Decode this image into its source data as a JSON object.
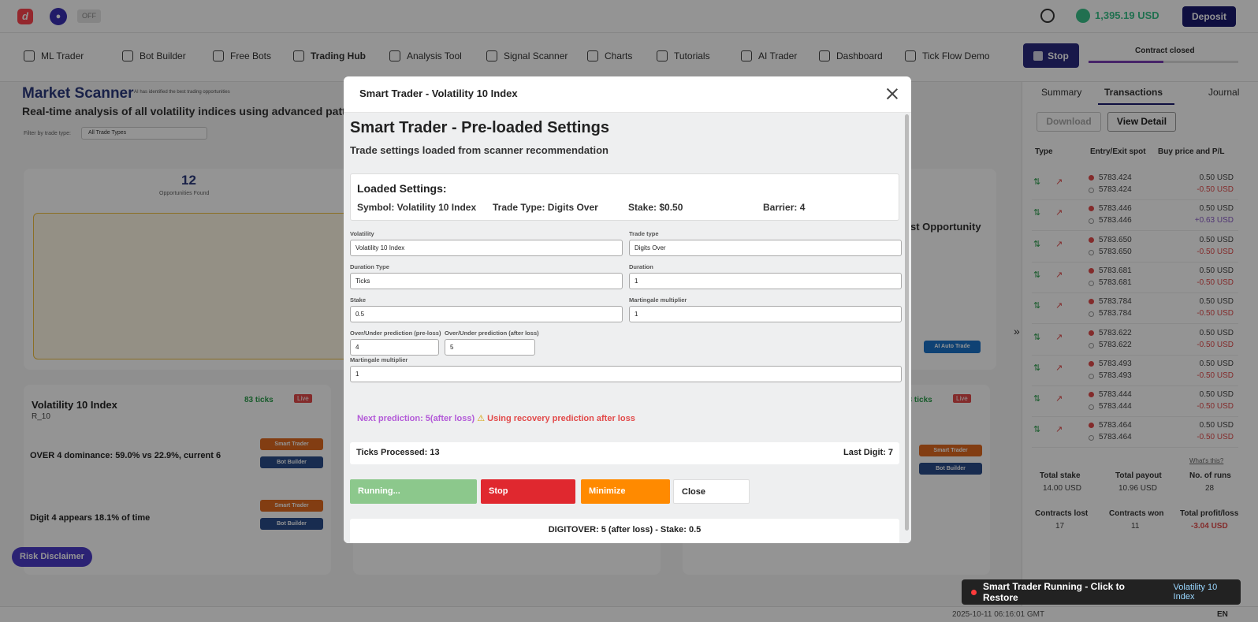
{
  "topbar": {
    "logo": "d",
    "off_label": "OFF",
    "balance": "1,395.19 USD",
    "deposit_label": "Deposit"
  },
  "nav": {
    "items": [
      "ML Trader",
      "Bot Builder",
      "Free Bots",
      "Trading Hub",
      "Analysis Tool",
      "Signal Scanner",
      "Charts",
      "Tutorials",
      "AI Trader",
      "Dashboard",
      "Tick Flow Demo"
    ],
    "active": "Trading Hub",
    "stop_label": "Stop",
    "contract_status": "Contract closed"
  },
  "scanner": {
    "title": "Market Scanner",
    "badge": "AI has identified the best trading opportunities",
    "subtitle": "Real-time analysis of all volatility indices using advanced pattern",
    "filter_label": "Filter by trade type:",
    "filter_value": "All Trade Types",
    "opportunities_count": "12",
    "opportunities_label": "Opportunities Found",
    "best_opportunity": "st Opportunity",
    "ai_auto_trade": "AI Auto Trade",
    "card": {
      "title": "Volatility 10 Index",
      "symbol": "R_10",
      "ticks": "83 ticks",
      "live": "Live",
      "line1": "OVER 4 dominance: 59.0% vs 22.9%, current 6",
      "line2": "Digit 4 appears 18.1% of time",
      "smart_trader": "Smart Trader",
      "bot_builder": "Bot Builder"
    },
    "risk_disclaimer": "Risk Disclaimer"
  },
  "right_panel": {
    "tabs": [
      "Summary",
      "Transactions",
      "Journal"
    ],
    "active_tab": "Transactions",
    "download_label": "Download",
    "view_detail_label": "View Detail",
    "headers": [
      "Type",
      "Entry/Exit spot",
      "Buy price and P/L"
    ],
    "transactions": [
      {
        "entry": "5783.424",
        "exit": "5783.424",
        "buy": "0.50 USD",
        "pl": "-0.50 USD"
      },
      {
        "entry": "5783.446",
        "exit": "5783.446",
        "buy": "0.50 USD",
        "pl": "+0.63 USD"
      },
      {
        "entry": "5783.650",
        "exit": "5783.650",
        "buy": "0.50 USD",
        "pl": "-0.50 USD"
      },
      {
        "entry": "5783.681",
        "exit": "5783.681",
        "buy": "0.50 USD",
        "pl": "-0.50 USD"
      },
      {
        "entry": "5783.784",
        "exit": "5783.784",
        "buy": "0.50 USD",
        "pl": "-0.50 USD"
      },
      {
        "entry": "5783.622",
        "exit": "5783.622",
        "buy": "0.50 USD",
        "pl": "-0.50 USD"
      },
      {
        "entry": "5783.493",
        "exit": "5783.493",
        "buy": "0.50 USD",
        "pl": "-0.50 USD"
      },
      {
        "entry": "5783.444",
        "exit": "5783.444",
        "buy": "0.50 USD",
        "pl": "-0.50 USD"
      },
      {
        "entry": "5783.464",
        "exit": "5783.464",
        "buy": "0.50 USD",
        "pl": "-0.50 USD"
      }
    ],
    "whats_this": "What's this?",
    "stats": {
      "total_stake_label": "Total stake",
      "total_stake": "14.00 USD",
      "total_payout_label": "Total payout",
      "total_payout": "10.96 USD",
      "runs_label": "No. of runs",
      "runs": "28",
      "lost_label": "Contracts lost",
      "lost": "17",
      "won_label": "Contracts won",
      "won": "11",
      "pl_label": "Total profit/loss",
      "pl": "-3.04 USD"
    }
  },
  "statusbar": {
    "time": "2025-10-11 06:16:01 GMT",
    "lang": "EN"
  },
  "toast": {
    "text": "Smart Trader Running - Click to Restore",
    "symbol": "Volatility 10 Index"
  },
  "modal": {
    "title": "Smart Trader - Volatility 10 Index",
    "heading": "Smart Trader - Pre-loaded Settings",
    "subheading": "Trade settings loaded from scanner recommendation",
    "loaded": {
      "title": "Loaded Settings:",
      "symbol": "Symbol: Volatility 10 Index",
      "trade_type": "Trade Type: Digits Over",
      "stake": "Stake: $0.50",
      "barrier": "Barrier: 4"
    },
    "fields": {
      "volatility_label": "Volatility",
      "volatility": "Volatility 10 Index",
      "trade_type_label": "Trade type",
      "trade_type": "Digits Over",
      "duration_type_label": "Duration Type",
      "duration_type": "Ticks",
      "duration_label": "Duration",
      "duration": "1",
      "stake_label": "Stake",
      "stake": "0.5",
      "martingale_label": "Martingale multiplier",
      "martingale": "1",
      "pre_loss_label": "Over/Under prediction (pre-loss)",
      "pre_loss": "4",
      "after_loss_label": "Over/Under prediction (after loss)",
      "after_loss": "5",
      "martingale2_label": "Martingale multiplier",
      "martingale2": "1"
    },
    "next_prediction": "Next prediction: 5(after loss)",
    "recovery": "Using recovery prediction after loss",
    "ticks_processed": "Ticks Processed: 13",
    "last_digit": "Last Digit: 7",
    "buttons": {
      "running": "Running...",
      "stop": "Stop",
      "minimize": "Minimize",
      "close": "Close"
    },
    "status_line": "DIGITOVER: 5 (after loss) - Stake: 0.5"
  }
}
